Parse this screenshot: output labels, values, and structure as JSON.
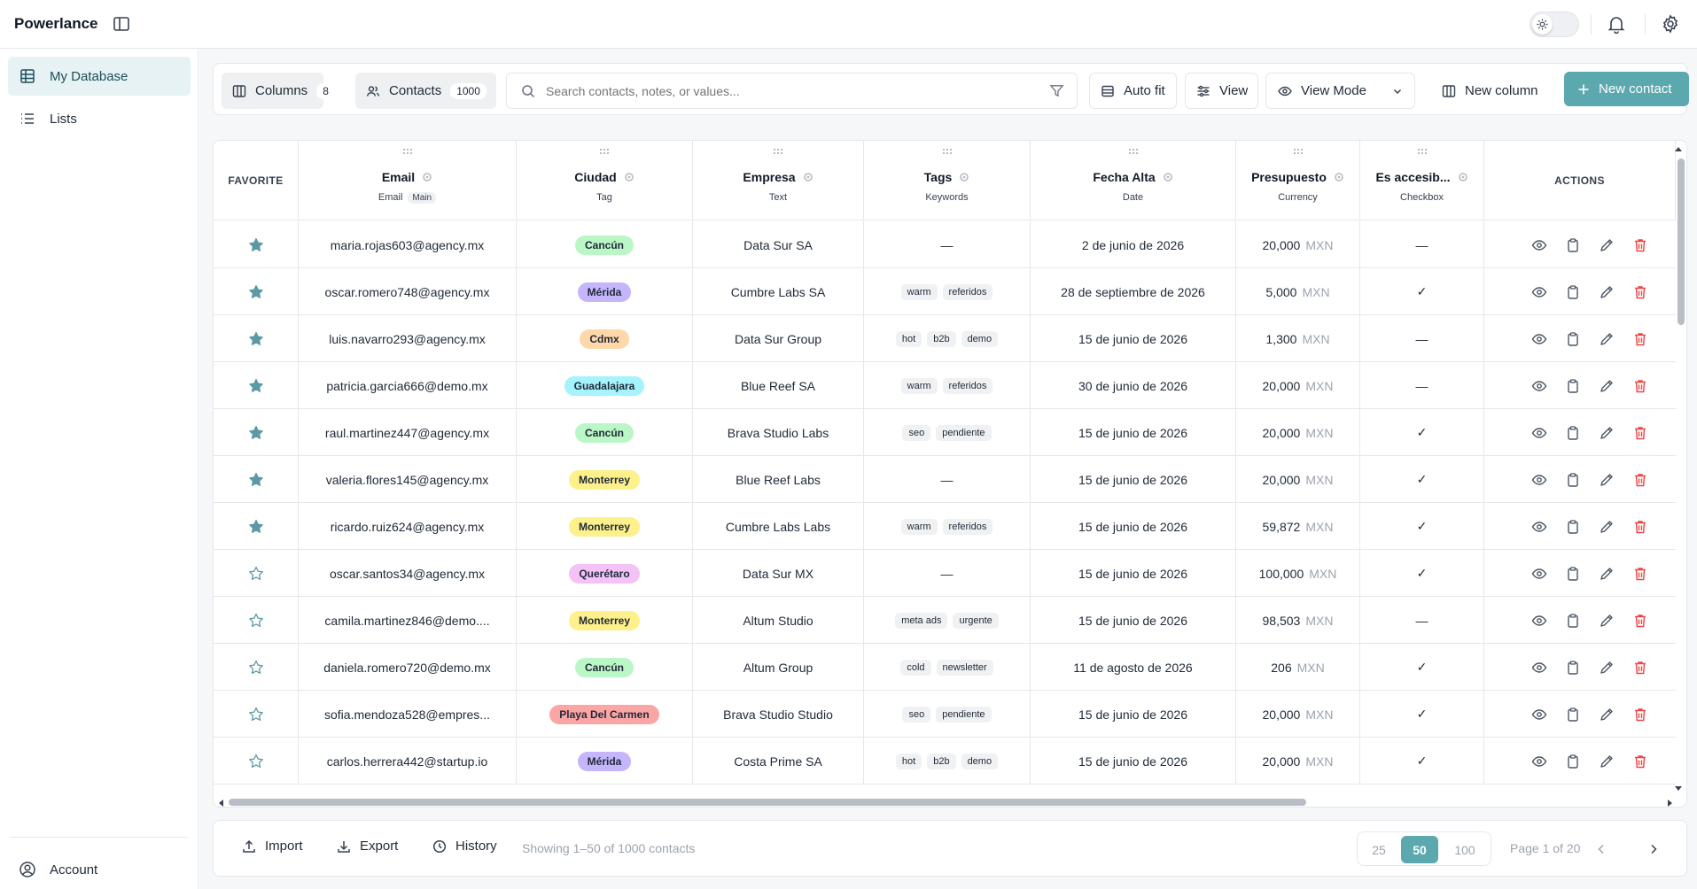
{
  "app": {
    "brand": "Powerlance"
  },
  "sidebar": {
    "items": [
      {
        "label": "My Database"
      },
      {
        "label": "Lists"
      }
    ],
    "account": "Account"
  },
  "toolbar": {
    "columns_label": "Columns",
    "columns_count": "8",
    "contacts_label": "Contacts",
    "contacts_count": "1000",
    "search_placeholder": "Search contacts, notes, or values...",
    "auto_fit": "Auto fit",
    "view": "View",
    "view_mode": "View Mode",
    "new_column": "New column",
    "new_contact": "New contact"
  },
  "columns": [
    {
      "name": "FAVORITE",
      "type": ""
    },
    {
      "name": "Email",
      "type": "Email",
      "badge": "Main"
    },
    {
      "name": "Ciudad",
      "type": "Tag"
    },
    {
      "name": "Empresa",
      "type": "Text"
    },
    {
      "name": "Tags",
      "type": "Keywords"
    },
    {
      "name": "Fecha Alta",
      "type": "Date"
    },
    {
      "name": "Presupuesto",
      "type": "Currency"
    },
    {
      "name": "Es accesib...",
      "type": "Checkbox"
    },
    {
      "name": "ACTIONS",
      "type": ""
    }
  ],
  "rows": [
    {
      "fav": true,
      "email": "maria.rojas603@agency.mx",
      "city": "Cancún",
      "company": "Data Sur SA",
      "tags": [],
      "date": "2 de junio de 2026",
      "amount": "20,000",
      "currency": "MXN",
      "access": "—"
    },
    {
      "fav": true,
      "email": "oscar.romero748@agency.mx",
      "city": "Mérida",
      "company": "Cumbre Labs SA",
      "tags": [
        "warm",
        "referidos"
      ],
      "date": "28 de septiembre de 2026",
      "amount": "5,000",
      "currency": "MXN",
      "access": "✓"
    },
    {
      "fav": true,
      "email": "luis.navarro293@agency.mx",
      "city": "Cdmx",
      "company": "Data Sur Group",
      "tags": [
        "hot",
        "b2b",
        "demo"
      ],
      "date": "15 de junio de 2026",
      "amount": "1,300",
      "currency": "MXN",
      "access": "—"
    },
    {
      "fav": true,
      "email": "patricia.garcia666@demo.mx",
      "city": "Guadalajara",
      "company": "Blue Reef SA",
      "tags": [
        "warm",
        "referidos"
      ],
      "date": "30 de junio de 2026",
      "amount": "20,000",
      "currency": "MXN",
      "access": "—"
    },
    {
      "fav": true,
      "email": "raul.martinez447@agency.mx",
      "city": "Cancún",
      "company": "Brava Studio Labs",
      "tags": [
        "seo",
        "pendiente"
      ],
      "date": "15 de junio de 2026",
      "amount": "20,000",
      "currency": "MXN",
      "access": "✓"
    },
    {
      "fav": true,
      "email": "valeria.flores145@agency.mx",
      "city": "Monterrey",
      "company": "Blue Reef Labs",
      "tags": [],
      "date": "15 de junio de 2026",
      "amount": "20,000",
      "currency": "MXN",
      "access": "✓"
    },
    {
      "fav": true,
      "email": "ricardo.ruiz624@agency.mx",
      "city": "Monterrey",
      "company": "Cumbre Labs Labs",
      "tags": [
        "warm",
        "referidos"
      ],
      "date": "15 de junio de 2026",
      "amount": "59,872",
      "currency": "MXN",
      "access": "✓"
    },
    {
      "fav": false,
      "email": "oscar.santos34@agency.mx",
      "city": "Querétaro",
      "company": "Data Sur MX",
      "tags": [],
      "date": "15 de junio de 2026",
      "amount": "100,000",
      "currency": "MXN",
      "access": "✓"
    },
    {
      "fav": false,
      "email": "camila.martinez846@demo....",
      "city": "Monterrey",
      "company": "Altum Studio",
      "tags": [
        "meta ads",
        "urgente"
      ],
      "date": "15 de junio de 2026",
      "amount": "98,503",
      "currency": "MXN",
      "access": "—"
    },
    {
      "fav": false,
      "email": "daniela.romero720@demo.mx",
      "city": "Cancún",
      "company": "Altum Group",
      "tags": [
        "cold",
        "newsletter"
      ],
      "date": "11 de agosto de 2026",
      "amount": "206",
      "currency": "MXN",
      "access": "✓"
    },
    {
      "fav": false,
      "email": "sofia.mendoza528@empres...",
      "city": "Playa Del Carmen",
      "company": "Brava Studio Studio",
      "tags": [
        "seo",
        "pendiente"
      ],
      "date": "15 de junio de 2026",
      "amount": "20,000",
      "currency": "MXN",
      "access": "✓"
    },
    {
      "fav": false,
      "email": "carlos.herrera442@startup.io",
      "city": "Mérida",
      "company": "Costa Prime SA",
      "tags": [
        "hot",
        "b2b",
        "demo"
      ],
      "date": "15 de junio de 2026",
      "amount": "20,000",
      "currency": "MXN",
      "access": "✓"
    }
  ],
  "empty_value": "—",
  "city_colors": {
    "Cancún": "#bbf7c6",
    "Mérida": "#c4b5fd",
    "Cdmx": "#fed7aa",
    "Guadalajara": "#a5f3fc",
    "Monterrey": "#fef08a",
    "Querétaro": "#f5c2f8",
    "Playa Del Carmen": "#fca5a5"
  },
  "colors": {
    "accent": "#5ba8af",
    "star": "#5b9aa5",
    "danger": "#ef4444"
  },
  "footer": {
    "import": "Import",
    "export": "Export",
    "history": "History",
    "showing": "Showing 1–50 of 1000 contacts",
    "page_sizes": [
      "25",
      "50",
      "100"
    ],
    "selected_page_size": "50",
    "page_info": "Page 1 of 20"
  }
}
